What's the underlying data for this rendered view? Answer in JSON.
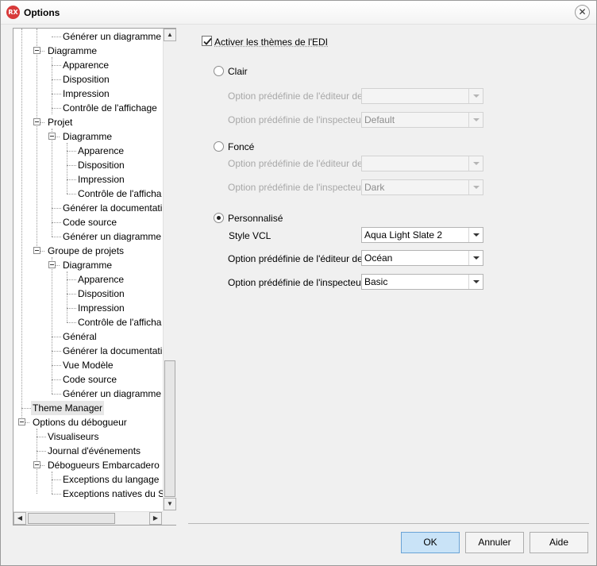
{
  "window": {
    "title": "Options",
    "app_icon_text": "RX",
    "close_glyph": "✕"
  },
  "tree": {
    "items": [
      {
        "label": "Générer un diagramme"
      },
      {
        "label": "Diagramme"
      },
      {
        "label": "Apparence"
      },
      {
        "label": "Disposition"
      },
      {
        "label": "Impression"
      },
      {
        "label": "Contrôle de l'affichage"
      },
      {
        "label": "Projet"
      },
      {
        "label": "Diagramme"
      },
      {
        "label": "Apparence"
      },
      {
        "label": "Disposition"
      },
      {
        "label": "Impression"
      },
      {
        "label": "Contrôle de l'afficha"
      },
      {
        "label": "Générer la documentati"
      },
      {
        "label": "Code source"
      },
      {
        "label": "Générer un diagramme"
      },
      {
        "label": "Groupe de projets"
      },
      {
        "label": "Diagramme"
      },
      {
        "label": "Apparence"
      },
      {
        "label": "Disposition"
      },
      {
        "label": "Impression"
      },
      {
        "label": "Contrôle de l'afficha"
      },
      {
        "label": "Général"
      },
      {
        "label": "Générer la documentati"
      },
      {
        "label": "Vue Modèle"
      },
      {
        "label": "Code source"
      },
      {
        "label": "Générer un diagramme"
      },
      {
        "label": "Theme Manager"
      },
      {
        "label": "Options du débogueur"
      },
      {
        "label": "Visualiseurs"
      },
      {
        "label": "Journal d'événements"
      },
      {
        "label": "Débogueurs Embarcadero"
      },
      {
        "label": "Exceptions du langage"
      },
      {
        "label": "Exceptions natives du SE"
      }
    ],
    "selected": "Theme Manager"
  },
  "settings": {
    "enable_themes": {
      "label": "Activer les thèmes de l'EDI",
      "checked": true
    },
    "clair": {
      "label": "Clair",
      "editor_label": "Option prédéfinie de l'éditeur de co",
      "editor_value": "",
      "inspector_label": "Option prédéfinie de l'inspecteur d'",
      "inspector_value": "Default"
    },
    "fonce": {
      "label": "Foncé",
      "editor_label": "Option prédéfinie de l'éditeur de co",
      "editor_value": "",
      "inspector_label": "Option prédéfinie de l'inspecteur d'",
      "inspector_value": "Dark"
    },
    "personnalise": {
      "label": "Personnalisé",
      "selected": true,
      "vcl_label": "Style VCL",
      "vcl_value": "Aqua Light Slate 2",
      "editor_label": "Option prédéfinie de l'éditeur de co",
      "editor_value": "Océan",
      "inspector_label": "Option prédéfinie de l'inspecteur d'",
      "inspector_value": "Basic"
    }
  },
  "buttons": {
    "ok": "OK",
    "cancel": "Annuler",
    "help": "Aide"
  },
  "icons": {
    "scroll_up": "▲",
    "scroll_down": "▼",
    "scroll_left": "◀",
    "scroll_right": "▶"
  }
}
